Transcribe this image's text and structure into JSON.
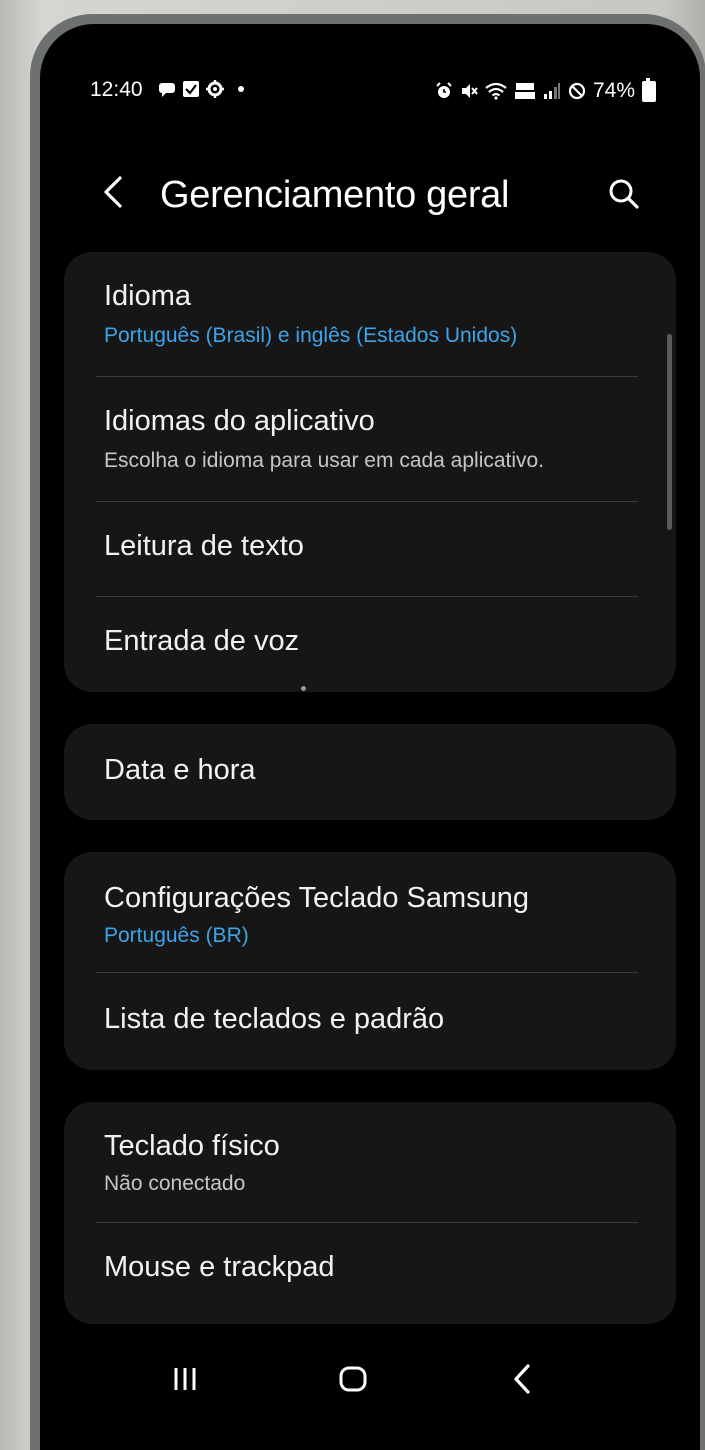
{
  "status": {
    "time": "12:40",
    "battery": "74%",
    "left_icons": [
      "message-icon",
      "checkbox-icon",
      "settings-gear-icon",
      "notification-dot"
    ],
    "right_icons": [
      "alarm-icon",
      "mute-icon",
      "wifi-icon",
      "volte-icon",
      "signal-icon",
      "do-not-disturb-icon",
      "battery-icon"
    ]
  },
  "header": {
    "title": "Gerenciamento geral",
    "back_icon": "chevron-left-icon",
    "search_icon": "search-icon"
  },
  "groups": [
    {
      "items": [
        {
          "title": "Idioma",
          "subtitle": "Português (Brasil) e inglês (Estados Unidos)",
          "subtitle_style": "accent"
        },
        {
          "title": "Idiomas do aplicativo",
          "subtitle": "Escolha o idioma para usar em cada aplicativo.",
          "subtitle_style": "gray"
        },
        {
          "title": "Leitura de texto"
        },
        {
          "title": "Entrada de voz"
        }
      ]
    },
    {
      "items": [
        {
          "title": "Data e hora"
        }
      ]
    },
    {
      "items": [
        {
          "title": "Configurações Teclado Samsung",
          "subtitle": "Português (BR)",
          "subtitle_style": "accent"
        },
        {
          "title": "Lista de teclados e padrão"
        }
      ]
    },
    {
      "items": [
        {
          "title": "Teclado físico",
          "subtitle": "Não conectado",
          "subtitle_style": "gray"
        },
        {
          "title": "Mouse e trackpad"
        }
      ]
    }
  ],
  "nav": {
    "recents_icon": "recents-icon",
    "home_icon": "home-icon",
    "back_icon": "back-icon"
  },
  "colors": {
    "accent": "#3fa3e8",
    "background": "#000000",
    "card": "#161616",
    "text": "#f2f2f2",
    "subtext": "#c6c6c6"
  }
}
